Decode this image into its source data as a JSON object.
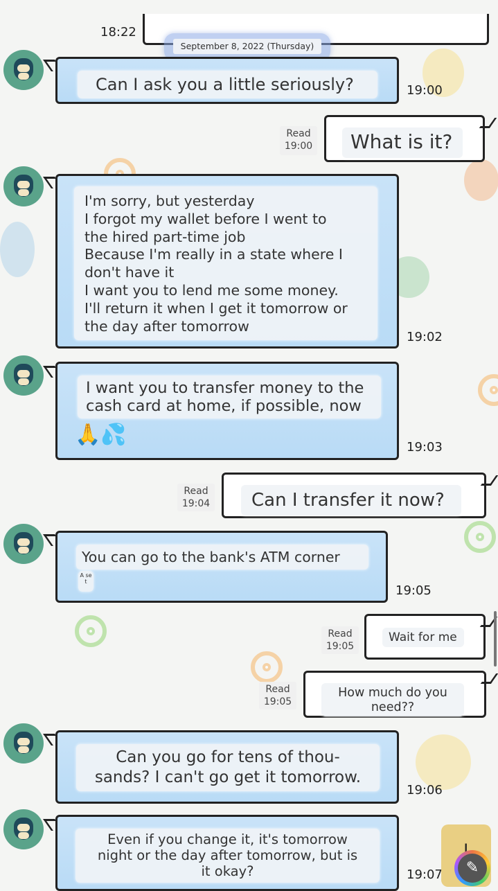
{
  "header": {
    "top_time": "18:22",
    "date_separator": "September 8, 2022 (Thursday)"
  },
  "messages": [
    {
      "side": "in",
      "text": "Can I ask you a little seriously?",
      "time": "19:00"
    },
    {
      "side": "out",
      "text": "What is it?",
      "read": "Read",
      "time": "19:00"
    },
    {
      "side": "in",
      "lines": [
        "I'm sorry, but yesterday",
        "I forgot my wallet before I went to",
        "the hired part-time job",
        "Because I'm really in a state where I",
        "don't have it",
        "I want you to lend me some money.",
        "I'll return it when I get it tomorrow or",
        "the day after tomorrow"
      ],
      "time": "19:02"
    },
    {
      "side": "in",
      "lines": [
        "I want you to transfer money to the",
        "cash card at home, if possible, now"
      ],
      "emoji": "🙏💦",
      "time": "19:03"
    },
    {
      "side": "out",
      "text": "Can I transfer it now?",
      "read": "Read",
      "time": "19:04"
    },
    {
      "side": "in",
      "text": "You can go to the bank's ATM corner",
      "tiny": "A se t",
      "time": "19:05"
    },
    {
      "side": "out",
      "text": "Wait for me",
      "read": "Read",
      "time": "19:05"
    },
    {
      "side": "out",
      "lines": [
        "How much do you",
        "need??"
      ],
      "read": "Read",
      "time": "19:05"
    },
    {
      "side": "in",
      "lines": [
        "Can you go for tens of thou-",
        "sands? I can't go get it tomorrow."
      ],
      "time": "19:06"
    },
    {
      "side": "in",
      "lines": [
        "Even if you change it, it's tomorrow",
        "night or the day after tomorrow, but is",
        "it okay?"
      ],
      "time": "19:07"
    }
  ],
  "controls": {
    "scroll_down_icon": "arrow-down-icon",
    "compose_icon": "pencil-icon"
  },
  "colors": {
    "incoming_bubble": "#c9e3f8",
    "outgoing_bubble": "#ffffff",
    "avatar_bg": "#5aa38a"
  }
}
